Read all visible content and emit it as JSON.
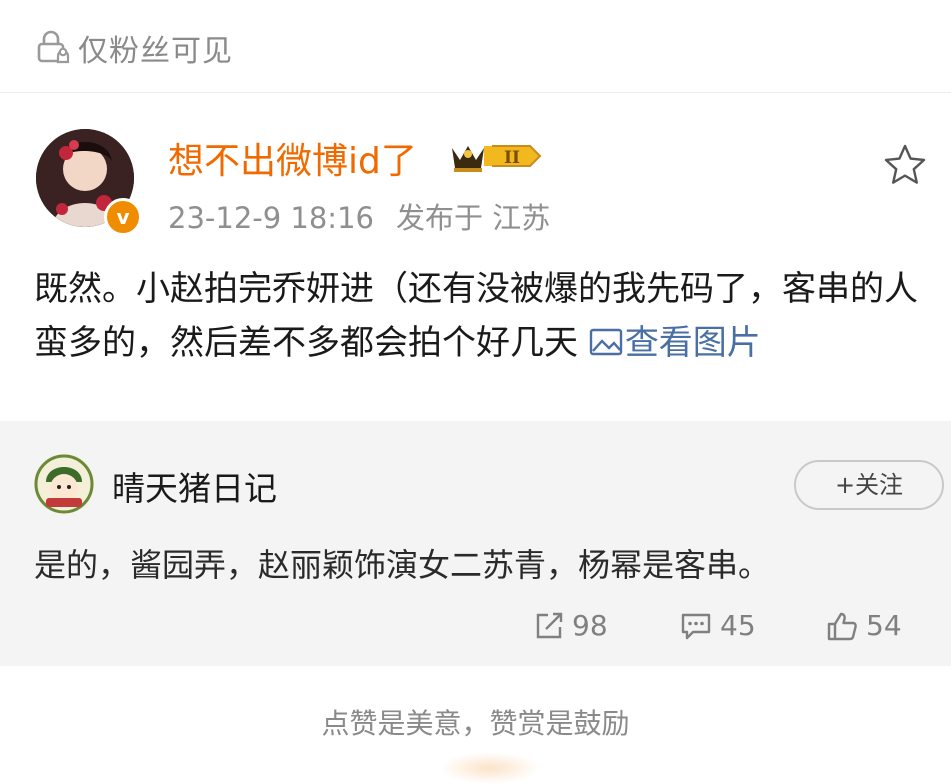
{
  "visibility": {
    "icon": "lock-icon",
    "label": "仅粉丝可见"
  },
  "post": {
    "author": "想不出微博id了",
    "badge_icon": "vip-crown-icon",
    "verified_icon": "verified-v-icon",
    "verified_mark": "v",
    "timestamp": "23-12-9 18:16",
    "location": "发布于 江苏",
    "text": "既然。小赵拍完乔妍进（还有没被爆的我先码了，客串的人蛮多的，然后差不多都会拍个好几天",
    "view_image_label": "查看图片",
    "favorite_icon": "star-icon"
  },
  "comment": {
    "author": "晴天猪日记",
    "follow_label": "+关注",
    "text": "是的，酱园弄，赵丽颖饰演女二苏青，杨幂是客串。",
    "repost_count": "98",
    "comment_count": "45",
    "like_count": "54"
  },
  "footer": {
    "note": "点赞是美意，赞赏是鼓励"
  },
  "colors": {
    "author_name": "#f06a00",
    "link": "#4a6fa5",
    "secondary_text": "#8f8f8f",
    "section_bg": "#f4f4f4"
  }
}
